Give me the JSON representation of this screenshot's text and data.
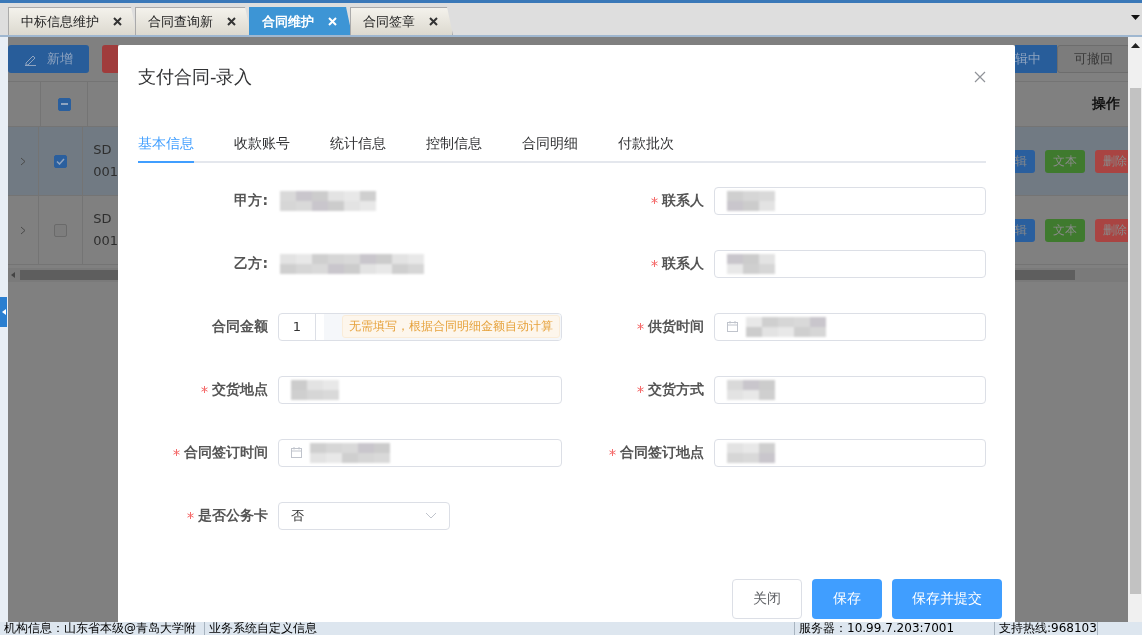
{
  "tabs": [
    {
      "label": "中标信息维护",
      "selected": false
    },
    {
      "label": "合同查询新",
      "selected": false
    },
    {
      "label": "合同维护",
      "selected": true
    },
    {
      "label": "合同签章",
      "selected": false
    }
  ],
  "background": {
    "toolbar_left": [
      {
        "kind": "primary",
        "label": "新增"
      },
      {
        "kind": "danger"
      }
    ],
    "toolbar_right": [
      {
        "kind": "primary",
        "label": "辑中"
      },
      {
        "kind": "default",
        "label": "可撤回"
      }
    ],
    "header_checkbox": {
      "indeterminate": true
    },
    "action_header": "操作",
    "rows": [
      {
        "selected": true,
        "checked": true,
        "code": "SD",
        "code_2": "001",
        "actions": [
          {
            "label": "辑",
            "color": "#2a5f9e"
          },
          {
            "label": "文本",
            "color": "#3f7a2e"
          },
          {
            "label": "删除",
            "color": "#a94442"
          }
        ]
      },
      {
        "selected": false,
        "checked": false,
        "code": "SD",
        "code_2": "001",
        "actions": [
          {
            "label": "辑",
            "color": "#2a5f9e"
          },
          {
            "label": "文本",
            "color": "#3f7a2e"
          },
          {
            "label": "删除",
            "color": "#a94442"
          }
        ]
      }
    ]
  },
  "dialog": {
    "title": "支付合同-录入",
    "tabs": [
      {
        "label": "基本信息",
        "selected": true
      },
      {
        "label": "收款账号",
        "selected": false
      },
      {
        "label": "统计信息",
        "selected": false
      },
      {
        "label": "控制信息",
        "selected": false
      },
      {
        "label": "合同明细",
        "selected": false
      },
      {
        "label": "付款批次",
        "selected": false
      }
    ],
    "fields": [
      {
        "label": "甲方:",
        "required": false,
        "kind": "static",
        "redacted": true
      },
      {
        "label": "联系人",
        "required": true,
        "kind": "text",
        "redacted": true
      },
      {
        "label": "乙方:",
        "required": false,
        "kind": "static",
        "redacted": true
      },
      {
        "label": "联系人",
        "required": true,
        "kind": "text",
        "redacted": true
      },
      {
        "label": "合同金额",
        "required": false,
        "kind": "amount",
        "value": "1",
        "hint": "无需填写，根据合同明细金额自动计算"
      },
      {
        "label": "供货时间",
        "required": true,
        "kind": "date",
        "redacted": true
      },
      {
        "label": "交货地点",
        "required": true,
        "kind": "text",
        "redacted": true
      },
      {
        "label": "交货方式",
        "required": true,
        "kind": "text",
        "redacted": true
      },
      {
        "label": "合同签订时间",
        "required": true,
        "kind": "date",
        "redacted": true
      },
      {
        "label": "合同签订地点",
        "required": true,
        "kind": "text",
        "redacted": true
      },
      {
        "label": "是否公务卡",
        "required": true,
        "kind": "select",
        "value": "否"
      }
    ],
    "buttons": [
      {
        "label": "关闭",
        "kind": "default"
      },
      {
        "label": "保存",
        "kind": "primary"
      },
      {
        "label": "保存并提交",
        "kind": "primary"
      }
    ]
  },
  "status_bar": [
    "机构信息：山东省本级@青岛大学附",
    "业务系统自定义信息",
    "服务器：10.99.7.203:7001",
    "支持热线:968103"
  ]
}
